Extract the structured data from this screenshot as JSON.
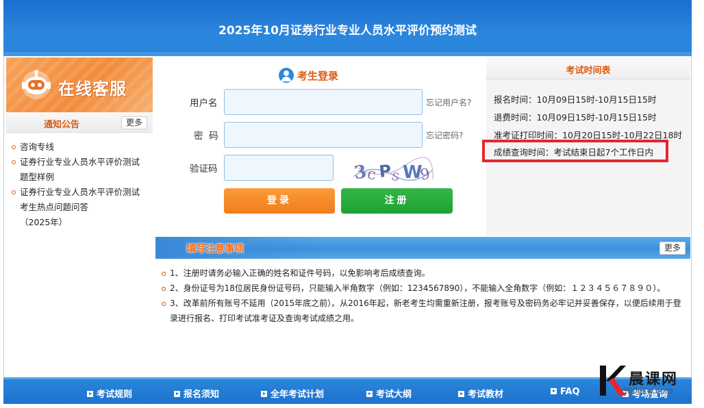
{
  "header": {
    "title": "2025年10月证券行业专业人员水平评价预约测试"
  },
  "service_banner": {
    "label": "在线客服"
  },
  "notice": {
    "title": "通知公告",
    "more_label": "更多",
    "items": [
      {
        "line1": "咨询专线",
        "line2": "",
        "line3": ""
      },
      {
        "line1": "证券行业专业人员水平评价测试",
        "line2": "题型样例",
        "line3": ""
      },
      {
        "line1": "证券行业专业人员水平评价测试",
        "line2": "考生热点问题问答",
        "line3": "（2025年）"
      }
    ]
  },
  "login": {
    "title": "考生登录",
    "username_label": "用户名",
    "username_value": "",
    "forgot_username": "忘记用户名?",
    "password_label": "密  码",
    "password_value": "",
    "forgot_password": "忘记密码?",
    "captcha_label": "验证码",
    "captcha_value": "",
    "captcha_image_text": "3cPsW9",
    "login_button": "登录",
    "register_button": "注册"
  },
  "schedule": {
    "title": "考试时间表",
    "rows": [
      "报名时间：10月09日15时-10月15日15时",
      "退费时间：10月09日15时-10月15日15时",
      "准考证打印时间：10月20日15时-10月22日18时",
      "成绩查询时间：考试结束日起7个工作日内"
    ],
    "highlight_color": "#e8252e"
  },
  "notes": {
    "title": "填写注意事项",
    "more_label": "更多",
    "items": [
      "1、注册时请务必输入正确的姓名和证件号码，以免影响考后成绩查询。",
      "2、身份证号为18位居民身份证号码，只能输入半角数字（例如：1234567890），不能输入全角数字（例如：１２３４５６７８９０）。",
      "3、改革前所有账号不延用（2015年底之前）。从2016年起，新老考生均需重新注册，报考账号及密码务必牢记并妥善保存，以便后续用于登录进行报名、打印考试准考证及查询考试成绩之用。"
    ]
  },
  "footer": {
    "links": [
      "考试规则",
      "报名须知",
      "全年考试计划",
      "考试大纲",
      "考试教材",
      "FAQ",
      "考场查询"
    ]
  },
  "watermark": {
    "name": "晨课网",
    "url": "360ckw.com"
  },
  "colors": {
    "header_blue": "#2b86de",
    "accent_orange": "#e0590f",
    "login_orange": "#f17d1a",
    "register_green": "#1fa334"
  }
}
